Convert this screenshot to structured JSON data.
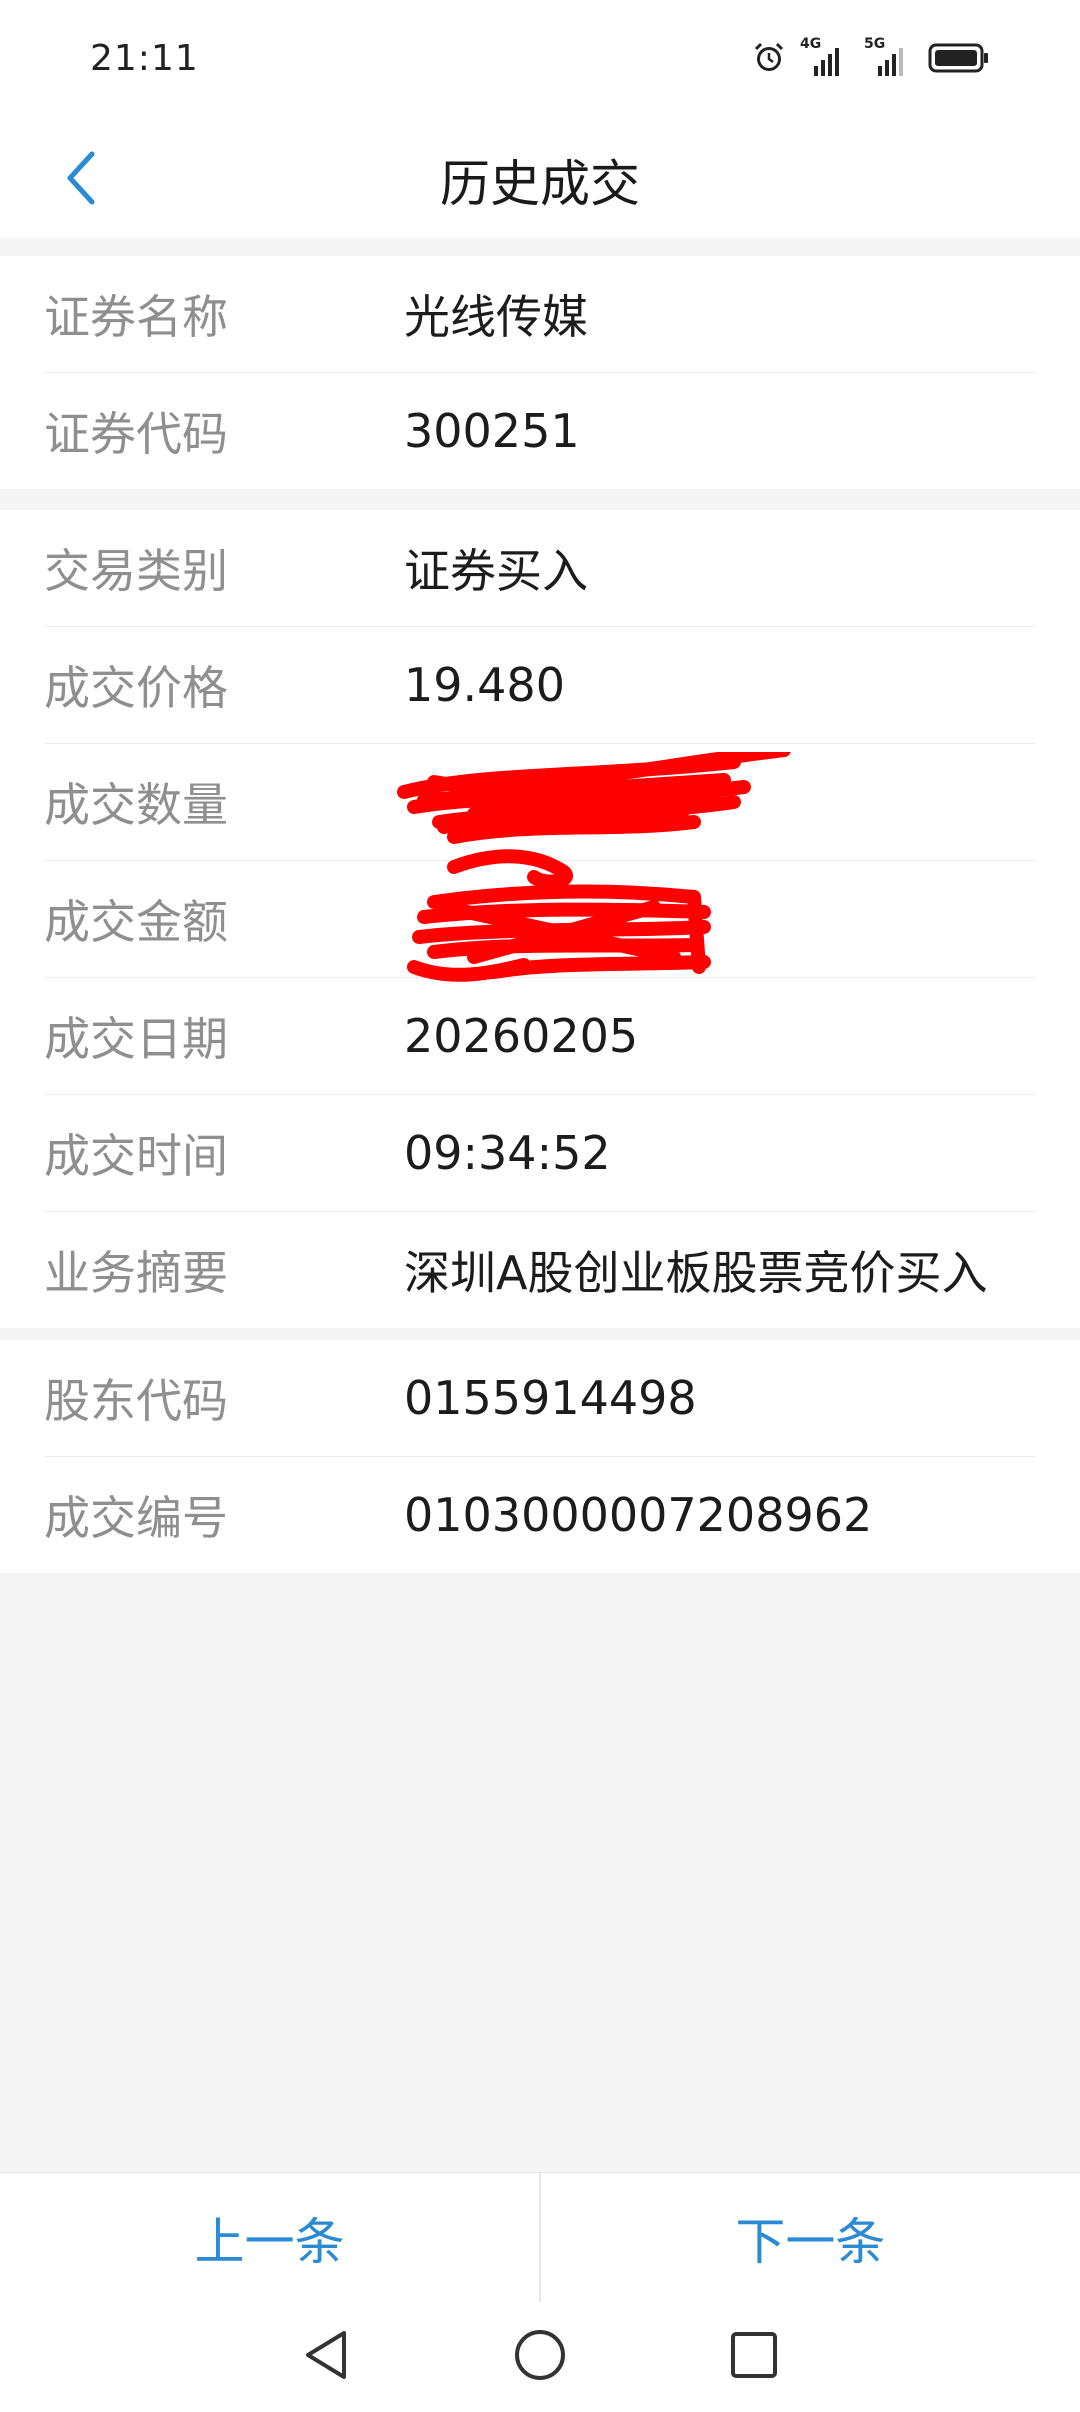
{
  "status_bar": {
    "time": "21:11",
    "icons": [
      "alarm-icon",
      "signal-4g-icon",
      "signal-5g-icon",
      "battery-icon"
    ],
    "signal_4g_label": "4G",
    "signal_5g_label": "5G"
  },
  "header": {
    "title": "历史成交",
    "back_icon": "chevron-left-icon",
    "accent_color": "#2a8ad4"
  },
  "section_security": [
    {
      "label": "证券名称",
      "value": "光线传媒"
    },
    {
      "label": "证券代码",
      "value": "300251"
    }
  ],
  "section_trade": [
    {
      "label": "交易类别",
      "value": "证券买入"
    },
    {
      "label": "成交价格",
      "value": "19.480"
    },
    {
      "label": "成交数量",
      "value": ""
    },
    {
      "label": "成交金额",
      "value": ""
    },
    {
      "label": "成交日期",
      "value": "20260205"
    },
    {
      "label": "成交时间",
      "value": "09:34:52"
    },
    {
      "label": "业务摘要",
      "value": "深圳A股创业板股票竞价买入"
    }
  ],
  "section_account": [
    {
      "label": "股东代码",
      "value": "0155914498"
    },
    {
      "label": "成交编号",
      "value": "0103000007208962"
    }
  ],
  "bottom_buttons": {
    "prev_label": "上一条",
    "next_label": "下一条"
  },
  "redaction_color": "#ff0000"
}
